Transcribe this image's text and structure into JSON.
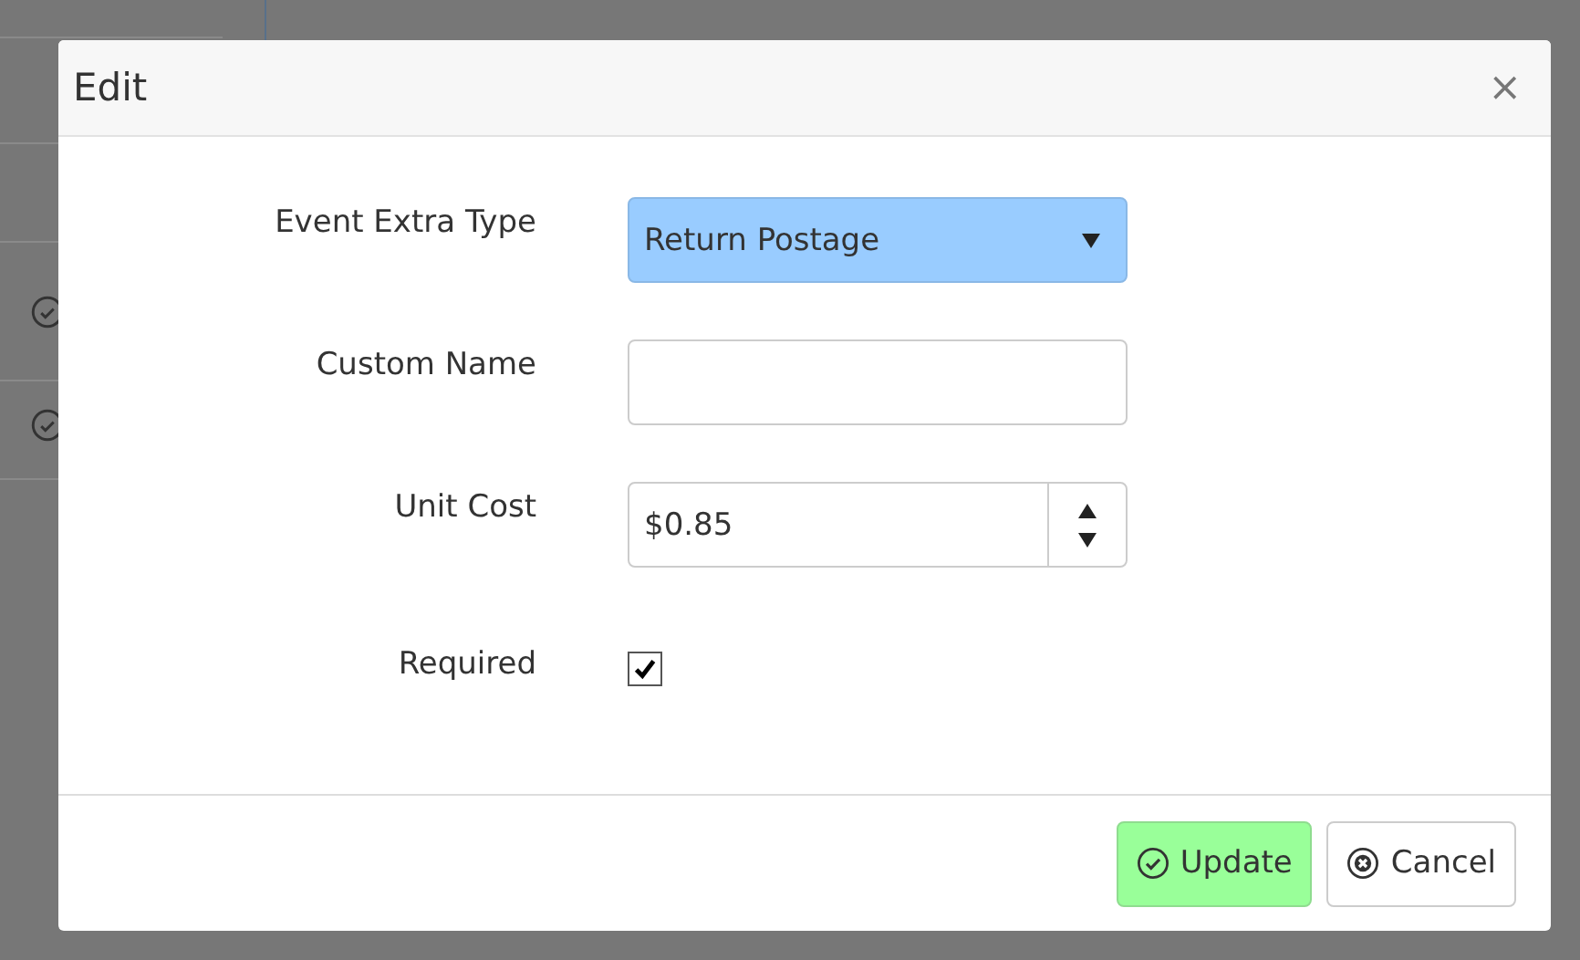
{
  "dialog": {
    "title": "Edit",
    "close": "×"
  },
  "fields": [
    {
      "kind": "select",
      "label": "Event Extra Type",
      "value": "Return Postage",
      "focused": true
    },
    {
      "kind": "text",
      "label": "Custom Name"
    },
    {
      "kind": "number",
      "label": "Unit Cost",
      "value": "$0.85"
    },
    {
      "kind": "checkbox",
      "label": "Required",
      "checked": true
    }
  ],
  "buttons": [
    {
      "kind": "primary",
      "label": "Update"
    },
    {
      "kind": "default",
      "label": "Cancel"
    }
  ]
}
